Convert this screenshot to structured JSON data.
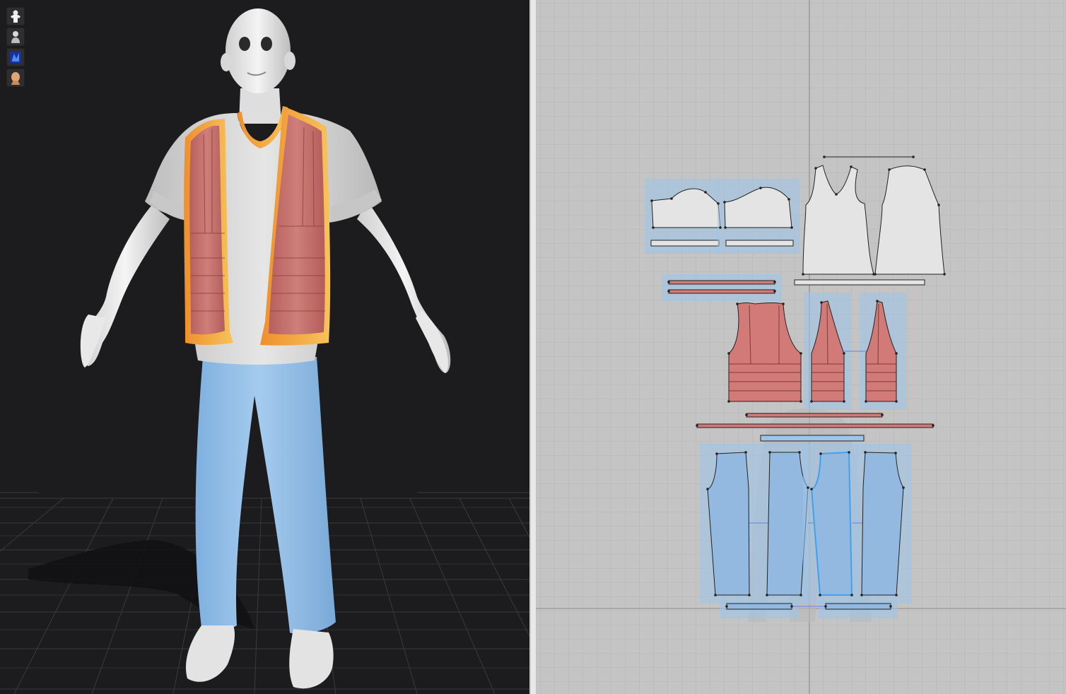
{
  "app": {
    "layout": "split-view"
  },
  "viewport3d": {
    "background": "#1c1c1e",
    "floor_grid_color": "#3a3a3c",
    "toolbar": [
      {
        "id": "garment",
        "icon": "shirt-avatar-icon",
        "label": ""
      },
      {
        "id": "avatar",
        "icon": "avatar-icon",
        "label": ""
      },
      {
        "id": "texture",
        "icon": "texture-mode-icon",
        "label": ""
      },
      {
        "id": "skin",
        "icon": "avatar-skin-icon",
        "label": ""
      }
    ]
  },
  "viewport2d": {
    "background": "#c4c4c4",
    "grid_color": "#b5b5b5",
    "axis_color": "#8a8a8a",
    "pattern_groups": [
      {
        "name": "t-shirt-sleeves",
        "color": "#e4e4e4",
        "count": 2
      },
      {
        "name": "t-shirt-body",
        "color": "#e4e4e4",
        "count": 2
      },
      {
        "name": "vest-body",
        "color": "#d17a78",
        "count": 3
      },
      {
        "name": "pants-legs",
        "color": "#9fc4e8",
        "count": 4
      }
    ]
  },
  "colors": {
    "vest": "#c46f6c",
    "vest_trim": "#f0a23c",
    "shirt": "#dcdcdc",
    "pants": "#8fbbe6",
    "selection": "#9cc4ea",
    "selected_outline": "#3fa2f0"
  }
}
